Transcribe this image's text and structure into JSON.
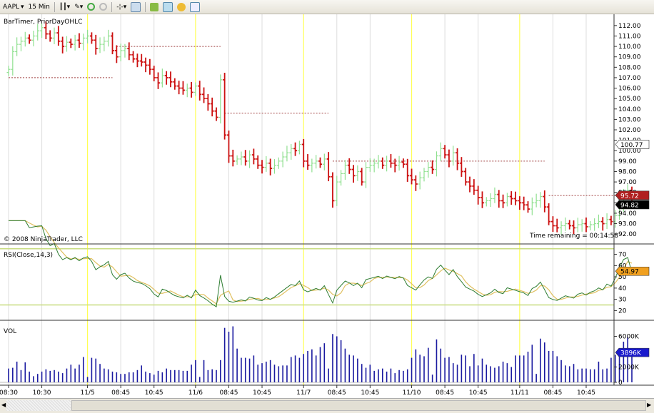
{
  "toolbar": {
    "instrument": "AAPL",
    "interval": "15 Min",
    "items": [
      "bar-type-icon",
      "draw-pencil-icon",
      "zoom-in-icon",
      "zoom-out-icon",
      "crosshair-icon",
      "properties-icon",
      "instrument-folder-icon",
      "strategy-chart-icon",
      "gold-coin-icon",
      "data-box-icon"
    ]
  },
  "chart": {
    "indicators_label": "BarTimer, PriorDayOHLC",
    "copyright": "© 2008 NinjaTrader, LLC",
    "time_remaining": "Time remaining = 00:14:58",
    "colors": {
      "up": "#90e090",
      "down": "#cc1111",
      "session": "#ffff55",
      "prior_line": "#a04040",
      "rsi": "#2e7d32",
      "rsi_avg": "#e0c060",
      "rsi_band": "#c8dc80",
      "volume": "#1a1aa0"
    },
    "price_axis": {
      "ticks": [
        "112.00",
        "111.00",
        "110.00",
        "109.00",
        "108.00",
        "107.00",
        "106.00",
        "105.00",
        "104.00",
        "103.00",
        "102.00",
        "101.00",
        "100.00",
        "99.00",
        "98.00",
        "97.00",
        "96.00",
        "95.00",
        "94.00",
        "93.00",
        "92.00"
      ],
      "range": [
        91.6,
        112.4
      ]
    },
    "price_labels": {
      "prior_close": "100.77",
      "prior_level": "95.72",
      "last": "94.82"
    },
    "closes": [
      107.8,
      109.5,
      110.2,
      110.5,
      110.8,
      110.6,
      111.0,
      111.5,
      111.8,
      111.2,
      110.8,
      111.3,
      110.5,
      110.0,
      110.4,
      110.2,
      110.6,
      110.3,
      110.8,
      111.0,
      110.6,
      109.8,
      110.2,
      110.5,
      111.0,
      109.6,
      109.0,
      109.6,
      109.8,
      109.2,
      108.8,
      108.6,
      108.5,
      108.2,
      107.8,
      107.0,
      106.5,
      107.2,
      107.0,
      106.6,
      106.2,
      106.0,
      105.8,
      106.0,
      105.6,
      106.2,
      105.4,
      105.0,
      104.5,
      103.8,
      103.2,
      106.8,
      101.5,
      99.5,
      99.0,
      99.2,
      99.4,
      99.0,
      99.6,
      99.2,
      98.6,
      98.4,
      98.8,
      98.3,
      98.6,
      99.0,
      99.4,
      99.8,
      100.2,
      100.0,
      100.6,
      99.0,
      98.6,
      98.8,
      99.0,
      98.7,
      99.2,
      97.5,
      95.2,
      97.0,
      97.8,
      98.6,
      98.2,
      97.6,
      98.0,
      97.0,
      98.4,
      98.6,
      98.8,
      99.0,
      98.6,
      99.0,
      98.8,
      98.6,
      98.9,
      98.7,
      97.6,
      97.2,
      96.8,
      97.4,
      98.0,
      98.4,
      98.2,
      99.5,
      100.2,
      99.6,
      99.0,
      99.8,
      98.8,
      98.0,
      97.0,
      96.6,
      96.2,
      95.5,
      95.0,
      95.2,
      95.4,
      95.8,
      95.2,
      95.0,
      95.6,
      95.4,
      95.2,
      95.0,
      94.8,
      94.4,
      95.0,
      95.2,
      95.6,
      94.6,
      93.2,
      92.8,
      92.6,
      92.8,
      93.0,
      92.8,
      92.6,
      92.9,
      93.0,
      92.7,
      92.9,
      93.0,
      93.2,
      93.0,
      93.4,
      93.2,
      93.8,
      94.8,
      95.9,
      96.2,
      94.82
    ],
    "prior_day_levels": [
      107.0,
      110.0,
      103.6,
      99.0,
      99.0,
      95.7
    ],
    "rsi": {
      "label": "RSI(Close,14,3)",
      "ticks": [
        "70",
        "60",
        "50",
        "40",
        "30",
        "20"
      ],
      "range": [
        12,
        78
      ],
      "bands": [
        75,
        25
      ],
      "last": "54.97"
    },
    "volume": {
      "label": "VOL",
      "ticks": [
        "6000K",
        "2000K",
        "0"
      ],
      "range": [
        0,
        8000
      ],
      "last": "3896K",
      "values": [
        1800,
        1900,
        2700,
        1600,
        2600,
        1400,
        800,
        1100,
        1400,
        1700,
        1500,
        1600,
        1400,
        1200,
        1800,
        2300,
        1800,
        2300,
        3300,
        700,
        3200,
        3100,
        2400,
        1800,
        1700,
        1400,
        1300,
        1100,
        1100,
        1300,
        1300,
        1600,
        2200,
        1400,
        1200,
        1000,
        1500,
        1300,
        1800,
        1600,
        1600,
        1600,
        1500,
        1500,
        2300,
        2900,
        700,
        2900,
        1600,
        1700,
        1600,
        2900,
        7100,
        6600,
        7300,
        4400,
        3200,
        3200,
        3100,
        3500,
        2300,
        2500,
        2700,
        2900,
        2300,
        2100,
        2200,
        2200,
        3300,
        3500,
        3200,
        3700,
        4100,
        4300,
        3500,
        4600,
        5100,
        1800,
        6300,
        6000,
        5500,
        4400,
        3600,
        3500,
        3100,
        2400,
        1900,
        2300,
        1500,
        1700,
        1800,
        1400,
        1800,
        1200,
        1600,
        1500,
        1700,
        3200,
        4300,
        3600,
        3400,
        4500,
        1000,
        5600,
        4400,
        3200,
        3300,
        2500,
        2300,
        3600,
        3500,
        2100,
        3700,
        2200,
        3100,
        2300,
        2100,
        1900,
        2100,
        2700,
        2500,
        2000,
        3500,
        3500,
        3500,
        4000,
        4900,
        1100,
        5700,
        5200,
        4100,
        4100,
        3400,
        2900,
        2200,
        2100,
        2400,
        1700,
        1800,
        1800,
        1700,
        1700,
        2700,
        1700,
        1800,
        3200,
        3600,
        4000,
        5300,
        5900,
        3896
      ]
    },
    "time_labels": [
      {
        "t": "08:30",
        "bar": 0
      },
      {
        "t": "10:30",
        "bar": 8
      },
      {
        "t": "11/5",
        "bar": 19,
        "session": true
      },
      {
        "t": "08:45",
        "bar": 27
      },
      {
        "t": "10:45",
        "bar": 35
      },
      {
        "t": "11/6",
        "bar": 45,
        "session": true
      },
      {
        "t": "08:45",
        "bar": 53
      },
      {
        "t": "10:45",
        "bar": 61
      },
      {
        "t": "11/7",
        "bar": 71,
        "session": true
      },
      {
        "t": "08:45",
        "bar": 79
      },
      {
        "t": "10:45",
        "bar": 87
      },
      {
        "t": "11/10",
        "bar": 97,
        "session": true
      },
      {
        "t": "08:45",
        "bar": 105
      },
      {
        "t": "10:45",
        "bar": 113
      },
      {
        "t": "11/11",
        "bar": 123,
        "session": true
      },
      {
        "t": "08:45",
        "bar": 131
      },
      {
        "t": "10:45",
        "bar": 139
      }
    ]
  }
}
